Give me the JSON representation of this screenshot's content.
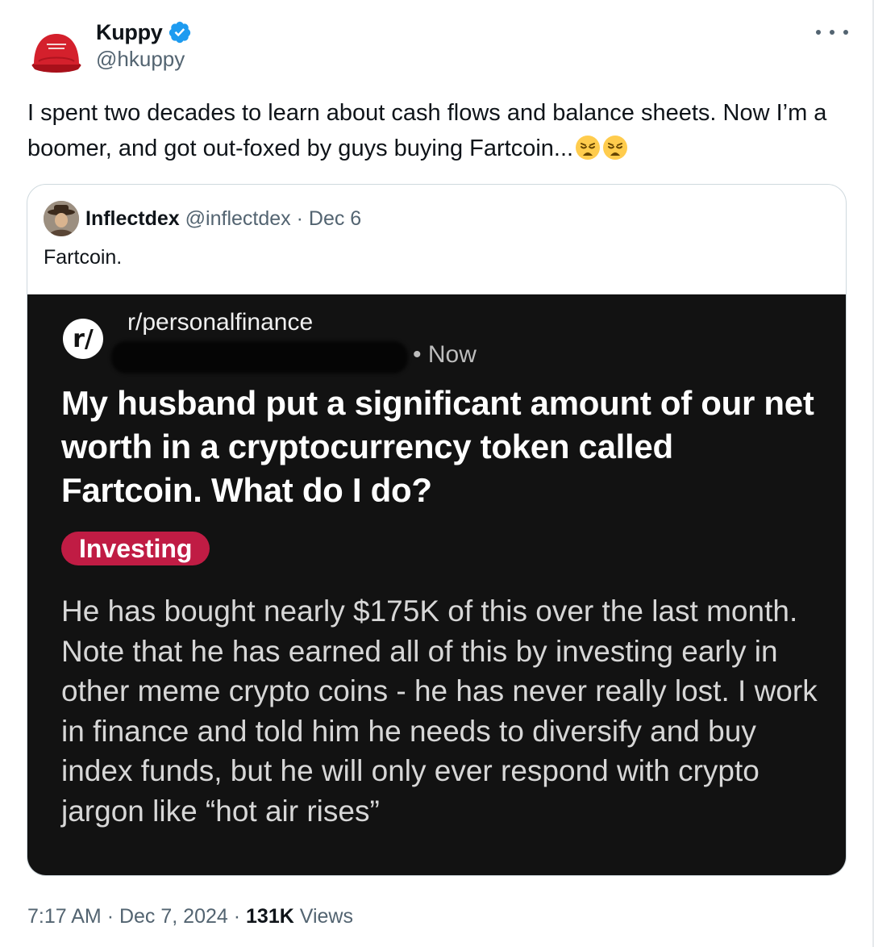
{
  "author": {
    "display_name": "Kuppy",
    "handle": "@hkuppy",
    "verified_icon": "verified-badge-icon",
    "avatar_icon": "red-cap-avatar"
  },
  "tweet": {
    "text": "I spent two decades to learn about cash flows and balance sheets. Now I’m a boomer, and got out-foxed by guys buying Fartcoin...",
    "emojis": [
      "weary-face-emoji",
      "weary-face-emoji"
    ]
  },
  "quote": {
    "display_name": "Inflectdex",
    "handle": "@inflectdex",
    "separator": "·",
    "date": "Dec 6",
    "text": "Fartcoin."
  },
  "reddit_post": {
    "logo_text": "r/",
    "subreddit": "r/personalfinance",
    "time": "• Now",
    "title": "My husband put a significant amount of our net worth in a cryptocurrency token called Fartcoin. What do I do?",
    "flair": "Investing",
    "body": "He has bought nearly $175K of this over the last month. Note that he has earned all of this by investing early in other meme crypto coins - he has never really lost. I work in finance and told him he needs to diversify and buy index funds, but he will only ever respond with crypto jargon like “hot air rises”"
  },
  "footer": {
    "time": "7:17 AM",
    "separator": "·",
    "date": "Dec 7, 2024",
    "views_count": "131K",
    "views_label": "Views"
  },
  "colors": {
    "verified": "#1d9bf0",
    "secondary_text": "#536471",
    "flair": "#c01c44",
    "card_bg": "#121212"
  }
}
